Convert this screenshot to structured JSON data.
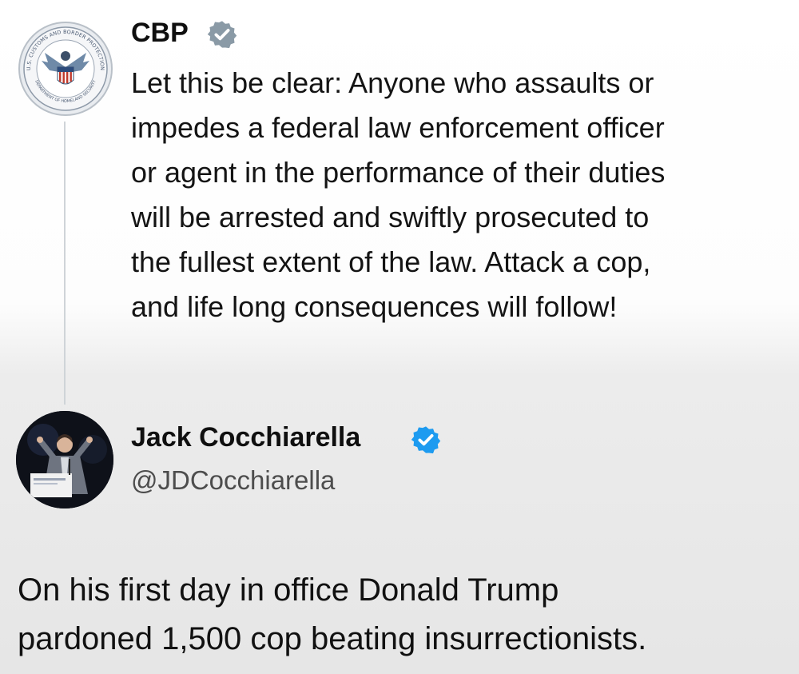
{
  "original_post": {
    "author_name": "CBP",
    "verified_badge": "gray-verified-badge-icon",
    "avatar": "cbp-seal",
    "seal_text_top": "U.S. CUSTOMS AND BORDER PROTECTION",
    "seal_text_bottom": "DEPARTMENT OF HOMELAND SECURITY",
    "text": "Let this be clear: Anyone who assaults or\nimpedes a federal law enforcement officer\nor agent in the performance of their duties\nwill be arrested and swiftly prosecuted to\nthe fullest extent of the law. Attack a cop,\nand life long consequences will follow!"
  },
  "reply_post": {
    "author_name": "Jack Cocchiarella",
    "handle": "@JDCocchiarella",
    "verified_badge": "blue-verified-badge-icon",
    "avatar": "person-at-podium-photo",
    "text": "On his first day in office Donald Trump\npardoned 1,500 cop beating insurrectionists."
  },
  "colors": {
    "gray_badge": "#8a9aa6",
    "blue_badge": "#1d9bf0",
    "thread_line": "#cfd4d8"
  }
}
